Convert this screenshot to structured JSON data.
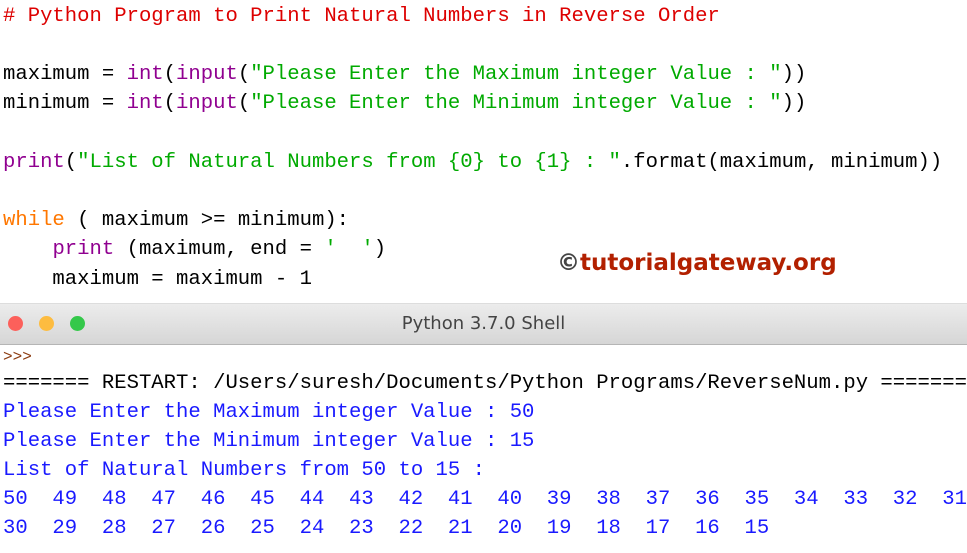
{
  "editor": {
    "lines": [
      [
        {
          "t": "# Python Program to Print Natural Numbers in Reverse Order",
          "c": "cm"
        }
      ],
      [
        {
          "t": "maximum = ",
          "c": "tx"
        },
        {
          "t": "int",
          "c": "bi"
        },
        {
          "t": "(",
          "c": "tx"
        },
        {
          "t": "input",
          "c": "bi"
        },
        {
          "t": "(",
          "c": "tx"
        },
        {
          "t": "\"Please Enter the Maximum integer Value : \"",
          "c": "st"
        },
        {
          "t": "))",
          "c": "tx"
        }
      ],
      [
        {
          "t": "minimum = ",
          "c": "tx"
        },
        {
          "t": "int",
          "c": "bi"
        },
        {
          "t": "(",
          "c": "tx"
        },
        {
          "t": "input",
          "c": "bi"
        },
        {
          "t": "(",
          "c": "tx"
        },
        {
          "t": "\"Please Enter the Minimum integer Value : \"",
          "c": "st"
        },
        {
          "t": "))",
          "c": "tx"
        }
      ],
      [
        {
          "t": "print",
          "c": "bi"
        },
        {
          "t": "(",
          "c": "tx"
        },
        {
          "t": "\"List of Natural Numbers from {0} to {1} : \"",
          "c": "st"
        },
        {
          "t": ".format(maximum, minimum))",
          "c": "tx"
        }
      ],
      [
        {
          "t": "while",
          "c": "kw"
        },
        {
          "t": " ( maximum >= minimum):",
          "c": "tx"
        }
      ],
      [
        {
          "t": "    ",
          "c": "tx"
        },
        {
          "t": "print",
          "c": "bi"
        },
        {
          "t": " (maximum, end = ",
          "c": "tx"
        },
        {
          "t": "'  '",
          "c": "st"
        },
        {
          "t": ")",
          "c": "tx"
        }
      ],
      [
        {
          "t": "    maximum = maximum - 1",
          "c": "tx"
        }
      ]
    ]
  },
  "watermark": {
    "symbol": "©",
    "text": "tutorialgateway.org"
  },
  "shell": {
    "title": "Python 3.7.0 Shell",
    "lines": [
      {
        "t": ">>>",
        "c": "pr"
      },
      {
        "t": "======= RESTART: /Users/suresh/Documents/Python Programs/ReverseNum.py =======",
        "c": "tx"
      },
      {
        "t": "Please Enter the Maximum integer Value : 50",
        "c": "out"
      },
      {
        "t": "Please Enter the Minimum integer Value : 15",
        "c": "out"
      },
      {
        "t": "List of Natural Numbers from 50 to 15 :",
        "c": "out"
      },
      {
        "t": "50  49  48  47  46  45  44  43  42  41  40  39  38  37  36  35  34  33  32  31",
        "c": "out"
      },
      {
        "t": "30  29  28  27  26  25  24  23  22  21  20  19  18  17  16  15",
        "c": "out"
      }
    ]
  },
  "colors": {
    "close": "#fc605b",
    "minimize": "#fdbc40",
    "zoom": "#34c84a"
  }
}
